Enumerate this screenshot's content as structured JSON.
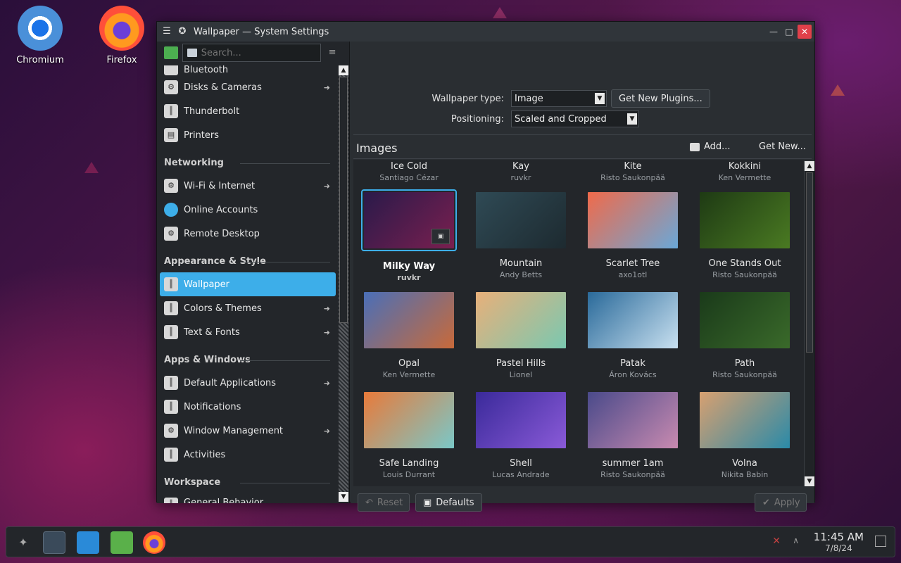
{
  "desktop": {
    "icons": [
      {
        "label": "Chromium"
      },
      {
        "label": "Firefox"
      }
    ]
  },
  "window": {
    "title": "Wallpaper — System Settings",
    "controls": {
      "minimize": "—",
      "maximize": "□",
      "close": "✕"
    }
  },
  "sidebar": {
    "search_placeholder": "Search...",
    "partial_top": "Bluetooth",
    "items": [
      {
        "label": "Disks & Cameras",
        "arrow": true
      },
      {
        "label": "Thunderbolt",
        "arrow": false
      },
      {
        "label": "Printers",
        "arrow": false
      }
    ],
    "sections": [
      {
        "title": "Networking",
        "items": [
          {
            "label": "Wi-Fi & Internet",
            "arrow": true
          },
          {
            "label": "Online Accounts",
            "arrow": false
          },
          {
            "label": "Remote Desktop",
            "arrow": false
          }
        ]
      },
      {
        "title": "Appearance & Style",
        "items": [
          {
            "label": "Wallpaper",
            "active": true
          },
          {
            "label": "Colors & Themes",
            "arrow": true
          },
          {
            "label": "Text & Fonts",
            "arrow": true
          }
        ]
      },
      {
        "title": "Apps & Windows",
        "items": [
          {
            "label": "Default Applications",
            "arrow": true
          },
          {
            "label": "Notifications",
            "arrow": false
          },
          {
            "label": "Window Management",
            "arrow": true
          },
          {
            "label": "Activities",
            "arrow": false
          }
        ]
      },
      {
        "title": "Workspace",
        "items": [
          {
            "label": "General Behavior"
          }
        ]
      }
    ]
  },
  "main": {
    "wallpaper_type_label": "Wallpaper type:",
    "wallpaper_type_value": "Image",
    "get_plugins_label": "Get New Plugins...",
    "positioning_label": "Positioning:",
    "positioning_value": "Scaled and Cropped",
    "images_title": "Images",
    "add_label": "Add...",
    "get_new_label": "Get New...",
    "header_row": [
      {
        "name": "Ice Cold",
        "author": "Santiago Cézar"
      },
      {
        "name": "Kay",
        "author": "ruvkr"
      },
      {
        "name": "Kite",
        "author": "Risto Saukonpää"
      },
      {
        "name": "Kokkini",
        "author": "Ken Vermette"
      }
    ],
    "wallpapers": [
      {
        "name": "Milky Way",
        "author": "ruvkr",
        "selected": true,
        "colors": [
          "#2a1a4a",
          "#7a1f4f"
        ]
      },
      {
        "name": "Mountain",
        "author": "Andy Betts",
        "colors": [
          "#2f4a55",
          "#1d2a30"
        ]
      },
      {
        "name": "Scarlet Tree",
        "author": "axo1otl",
        "colors": [
          "#f06a4a",
          "#6aa8d8"
        ]
      },
      {
        "name": "One Stands Out",
        "author": "Risto Saukonpää",
        "colors": [
          "#1e3a14",
          "#4a7a22"
        ]
      },
      {
        "name": "Opal",
        "author": "Ken Vermette",
        "colors": [
          "#4a6fb8",
          "#c86a3a"
        ]
      },
      {
        "name": "Pastel Hills",
        "author": "Lionel",
        "colors": [
          "#e8b07a",
          "#7ac8b0"
        ]
      },
      {
        "name": "Patak",
        "author": "Áron Kovács",
        "colors": [
          "#2a6a9a",
          "#c8e0f0"
        ]
      },
      {
        "name": "Path",
        "author": "Risto Saukonpää",
        "colors": [
          "#1a3a1a",
          "#3a6a2a"
        ]
      },
      {
        "name": "Safe Landing",
        "author": "Louis Durrant",
        "colors": [
          "#e87a3a",
          "#7ac8c8"
        ]
      },
      {
        "name": "Shell",
        "author": "Lucas Andrade",
        "colors": [
          "#3a2a9a",
          "#8a5ad8"
        ]
      },
      {
        "name": "summer 1am",
        "author": "Risto Saukonpää",
        "colors": [
          "#4a4a8a",
          "#c88ab0"
        ]
      },
      {
        "name": "Volna",
        "author": "Nikita Babin",
        "colors": [
          "#d8a070",
          "#2a8aa8"
        ]
      }
    ],
    "reset_label": "Reset",
    "defaults_label": "Defaults",
    "apply_label": "Apply"
  },
  "taskbar": {
    "time": "11:45 AM",
    "date": "7/8/24"
  }
}
